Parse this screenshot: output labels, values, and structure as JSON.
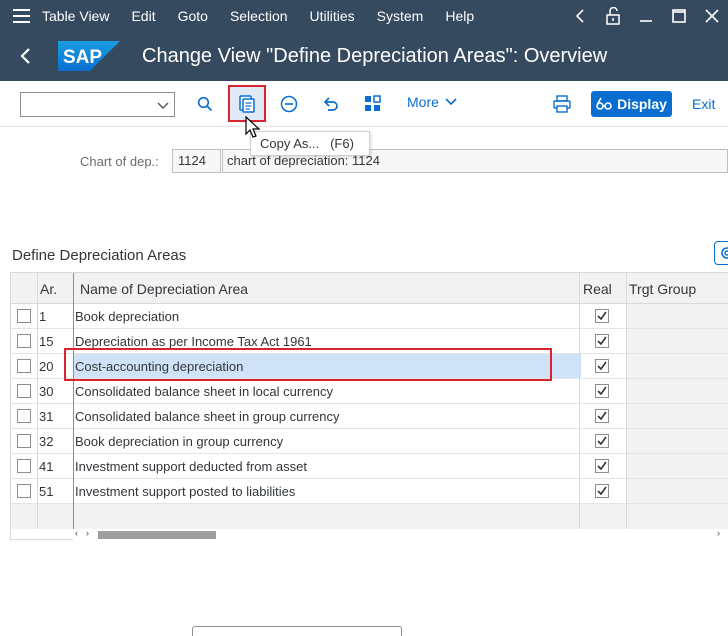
{
  "menu": {
    "items": [
      {
        "label": "Table View",
        "key": "T"
      },
      {
        "label": "Edit",
        "key": "E"
      },
      {
        "label": "Goto",
        "key": "G"
      },
      {
        "label": "Selection",
        "key": "l"
      },
      {
        "label": "Utilities",
        "key": "U"
      },
      {
        "label": "System",
        "key": "S"
      },
      {
        "label": "Help",
        "key": "H"
      }
    ]
  },
  "header": {
    "logo_text": "SAP",
    "title": "Change View \"Define Depreciation Areas\": Overview"
  },
  "toolbar": {
    "more_label": "More",
    "display_label": "Display",
    "exit_label": "Exit"
  },
  "tooltip": {
    "text": "Copy As...   (F6)"
  },
  "selection": {
    "chart_label": "Chart of dep.:",
    "chart_value": "1124",
    "chart_description": "chart of depreciation: 1124"
  },
  "table": {
    "title": "Define Depreciation Areas",
    "columns": [
      "Ar.",
      "Name of Depreciation Area",
      "Real",
      "Trgt Group"
    ],
    "rows": [
      {
        "ar": "1",
        "name": "Book depreciation",
        "real": true
      },
      {
        "ar": "15",
        "name": "Depreciation as per Income Tax  Act 1961",
        "real": true
      },
      {
        "ar": "20",
        "name": "Cost-accounting depreciation",
        "real": true
      },
      {
        "ar": "30",
        "name": "Consolidated balance sheet in local currency",
        "real": true
      },
      {
        "ar": "31",
        "name": "Consolidated balance sheet in group currency",
        "real": true
      },
      {
        "ar": "32",
        "name": "Book depreciation in group currency",
        "real": true
      },
      {
        "ar": "41",
        "name": "Investment support deducted from asset",
        "real": true
      },
      {
        "ar": "51",
        "name": "Investment support posted to liabilities",
        "real": true
      }
    ]
  },
  "colors": {
    "shell": "#354a5f",
    "accent": "#0a6ed1",
    "highlight_border": "#d9232e",
    "selected_row": "#cfe2f7"
  }
}
